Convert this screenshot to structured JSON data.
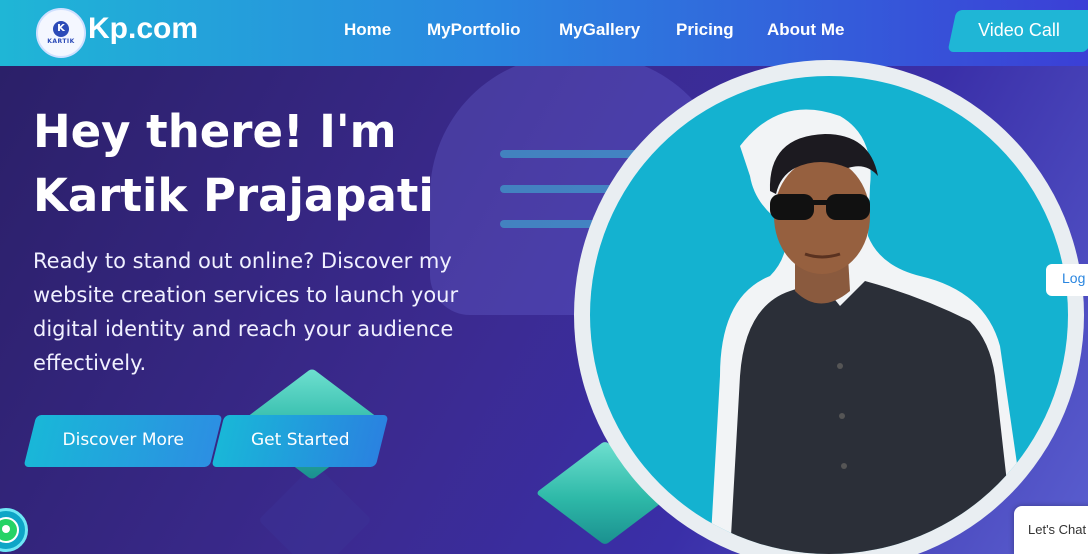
{
  "header": {
    "brand": "Kp.com",
    "logo_badge_text": "KARTIK",
    "logo_initial": "K",
    "nav": [
      {
        "label": "Home"
      },
      {
        "label": "MyPortfolio"
      },
      {
        "label": "MyGallery"
      },
      {
        "label": "Pricing"
      },
      {
        "label": "About Me"
      }
    ],
    "cta": "Video Call"
  },
  "hero": {
    "title_line1": "Hey there! I'm",
    "title_line2": "Kartik Prajapati",
    "description": "Ready to stand out online? Discover my website creation services to launch your digital identity and reach your audience effectively.",
    "buttons": {
      "discover": "Discover More",
      "started": "Get Started"
    }
  },
  "side_tabs": {
    "login": "Log",
    "chat": "Let's Chat"
  },
  "icons": [
    "whatsapp-icon"
  ],
  "colors": {
    "accent": "#1fb6d6",
    "header_gradient_start": "#1fb6d6",
    "header_gradient_end": "#3b3fd6",
    "background": "#3b2a8f"
  }
}
